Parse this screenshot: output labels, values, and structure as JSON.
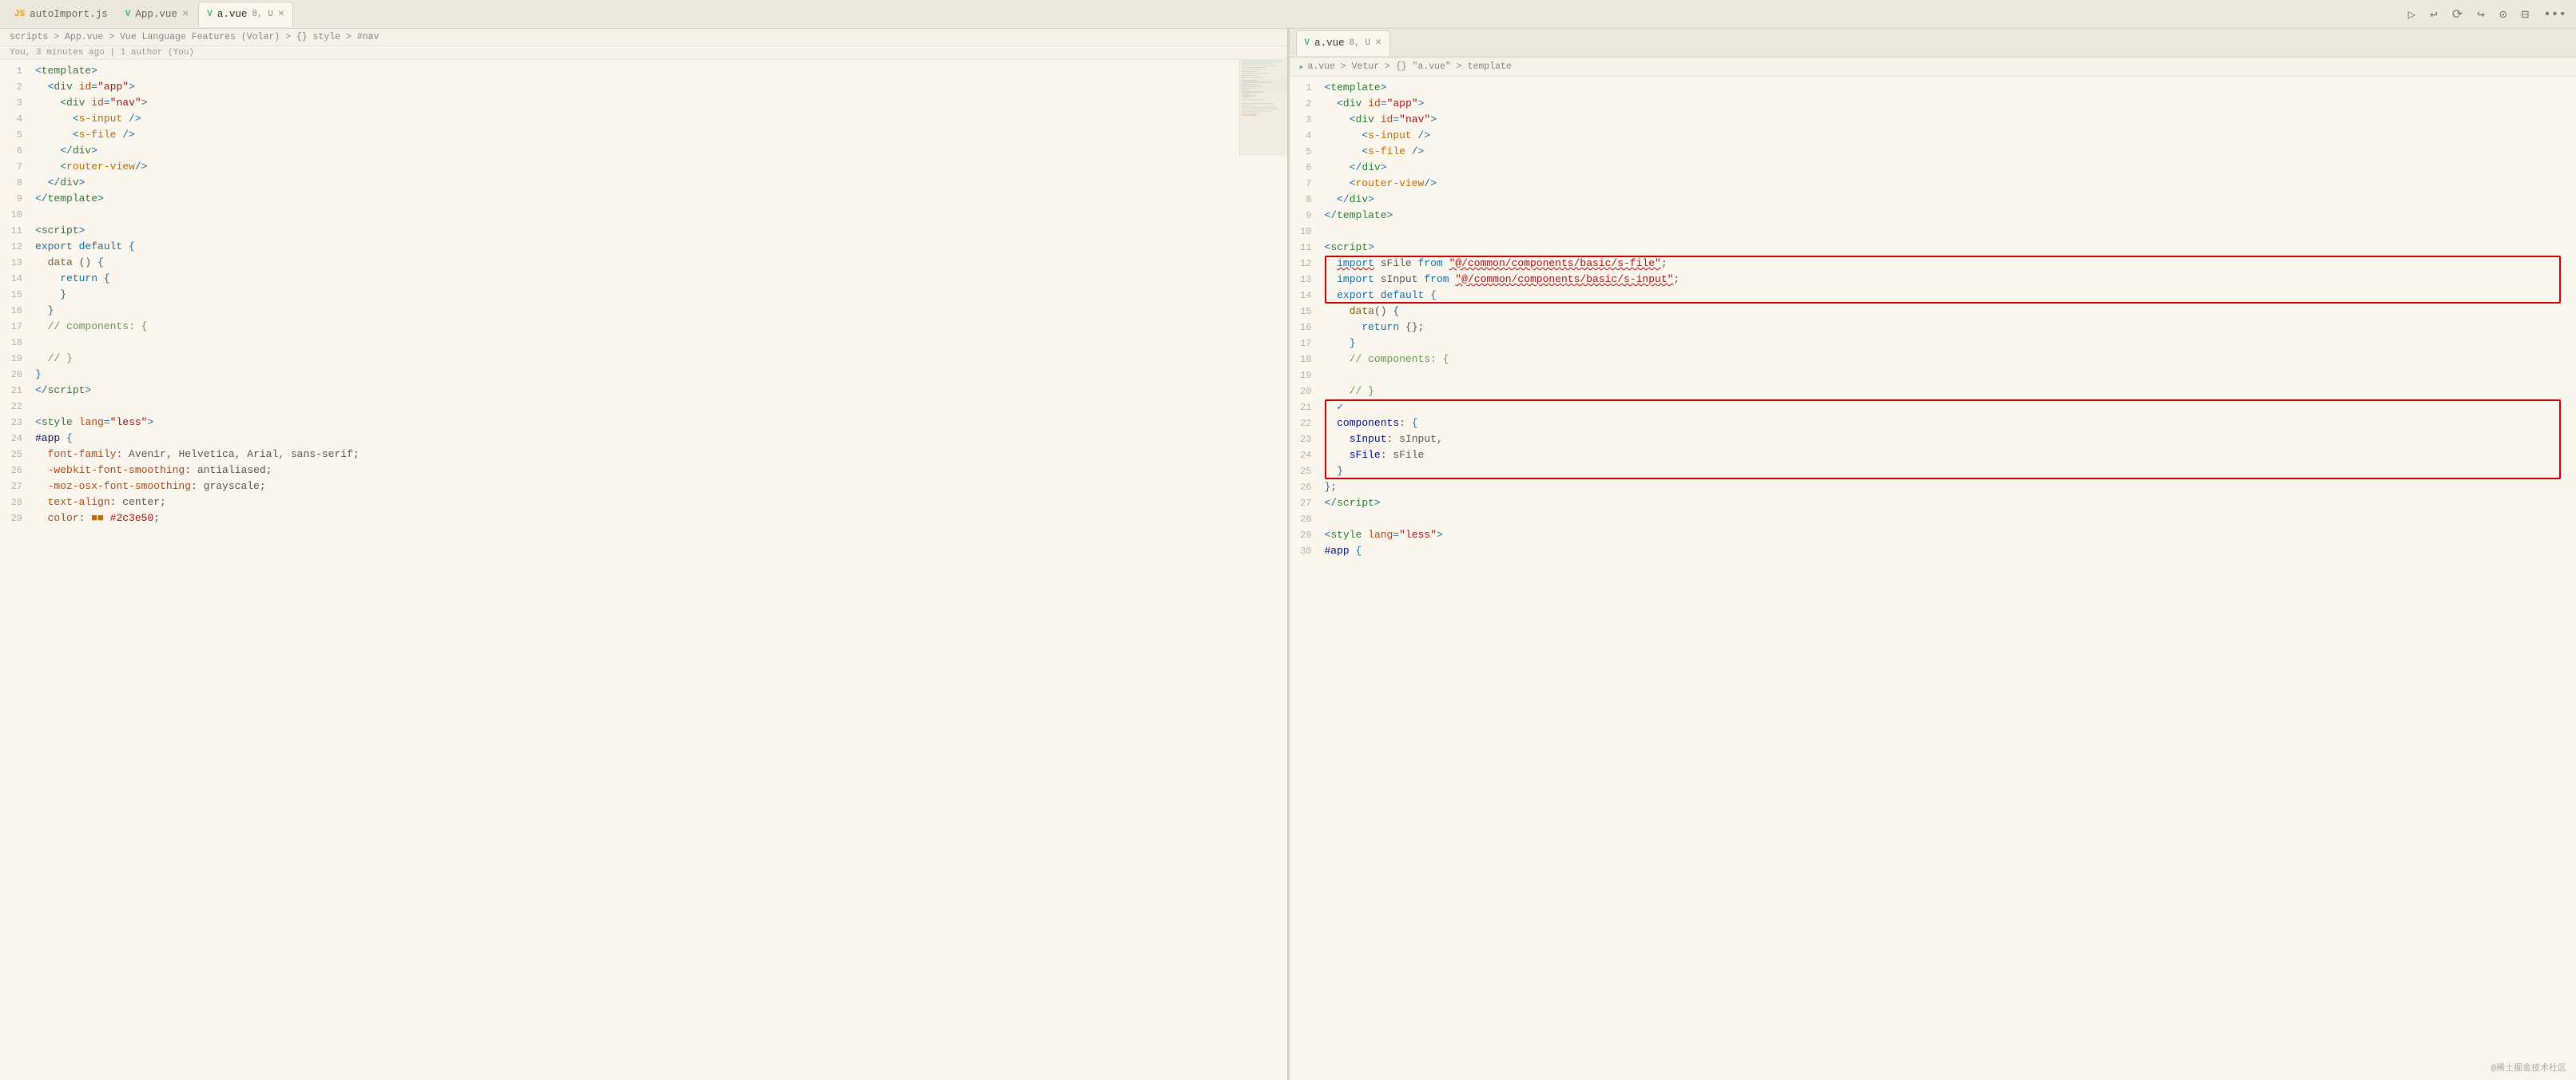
{
  "leftPanel": {
    "tabs": [
      {
        "label": "autoImport.js",
        "icon": "js",
        "active": false,
        "closable": false
      },
      {
        "label": "App.vue",
        "icon": "vue",
        "active": false,
        "closable": true
      },
      {
        "label": "a.vue",
        "badge": "8, U",
        "icon": "vue-green",
        "active": true,
        "closable": true
      }
    ],
    "breadcrumb": "scripts > App.vue > Vue Language Features (Volar) > {} style > #nav",
    "blame": "You, 3 minutes ago | 1 author (You)",
    "lines": [
      {
        "num": 1,
        "html": "<span class='kw-tag'>&lt;</span><span class='kw-name'>template</span><span class='kw-tag'>&gt;</span>"
      },
      {
        "num": 2,
        "html": "  <span class='kw-tag'>&lt;</span><span class='kw-name'>div</span> <span class='kw-attr'>id</span><span class='kw-tag'>=</span><span class='kw-string'>\"app\"</span><span class='kw-tag'>&gt;</span>"
      },
      {
        "num": 3,
        "html": "    <span class='kw-tag'>&lt;</span><span class='kw-name'>div</span> <span class='kw-attr'>id</span><span class='kw-tag'>=</span><span class='kw-string'>\"nav\"</span><span class='kw-tag'>&gt;</span>"
      },
      {
        "num": 4,
        "html": "      <span class='kw-tag'>&lt;</span><span class='kw-name kw-orange'>s-input</span> <span class='kw-tag'>/&gt;</span>"
      },
      {
        "num": 5,
        "html": "      <span class='kw-tag'>&lt;</span><span class='kw-name kw-orange'>s-file</span> <span class='kw-tag'>/&gt;</span>"
      },
      {
        "num": 6,
        "html": "    <span class='kw-tag'>&lt;/</span><span class='kw-name'>div</span><span class='kw-tag'>&gt;</span>"
      },
      {
        "num": 7,
        "html": "    <span class='kw-tag'>&lt;</span><span class='kw-name kw-orange'>router-view</span><span class='kw-tag'>/&gt;</span>"
      },
      {
        "num": 8,
        "html": "  <span class='kw-tag'>&lt;/</span><span class='kw-name'>div</span><span class='kw-tag'>&gt;</span>"
      },
      {
        "num": 9,
        "html": "<span class='kw-tag'>&lt;/</span><span class='kw-name'>template</span><span class='kw-tag'>&gt;</span>"
      },
      {
        "num": 10,
        "html": ""
      },
      {
        "num": 11,
        "html": "<span class='kw-tag'>&lt;</span><span class='kw-name'>script</span><span class='kw-tag'>&gt;</span>"
      },
      {
        "num": 12,
        "html": "<span class='kw-js-key'>export</span> <span class='kw-js-key'>default</span> <span class='kw-tag'>{</span>"
      },
      {
        "num": 13,
        "html": "  <span class='kw-js-fn'>data</span> () <span class='kw-tag'>{</span>"
      },
      {
        "num": 14,
        "html": "    <span class='kw-js-key'>return</span> <span class='kw-tag'>{</span>"
      },
      {
        "num": 15,
        "html": "    <span class='kw-tag'>}</span>"
      },
      {
        "num": 16,
        "html": "  <span class='kw-tag'>}</span>"
      },
      {
        "num": 17,
        "html": "  <span class='kw-comment'>// components: {</span>"
      },
      {
        "num": 18,
        "html": ""
      },
      {
        "num": 19,
        "html": "  <span class='kw-comment'>// }</span>"
      },
      {
        "num": 20,
        "html": "<span class='kw-tag'>}</span>"
      },
      {
        "num": 21,
        "html": "<span class='kw-tag'>&lt;/</span><span class='kw-name'>script</span><span class='kw-tag'>&gt;</span>"
      },
      {
        "num": 22,
        "html": ""
      },
      {
        "num": 23,
        "html": "<span class='kw-tag'>&lt;</span><span class='kw-name'>style</span> <span class='kw-attr'>lang</span><span class='kw-tag'>=</span><span class='kw-string'>\"less\"</span><span class='kw-tag'>&gt;</span>"
      },
      {
        "num": 24,
        "html": "<span class='kw-js-prop'>#app</span> <span class='kw-tag'>{</span>"
      },
      {
        "num": 25,
        "html": "  <span class='kw-attr'>font-family</span>: Avenir, Helvetica, Arial, sans-serif;"
      },
      {
        "num": 26,
        "html": "  <span class='kw-attr'>-webkit-font-smoothing</span>: antialiased;"
      },
      {
        "num": 27,
        "html": "  <span class='kw-attr'>-moz-osx-font-smoothing</span>: grayscale;"
      },
      {
        "num": 28,
        "html": "  <span class='kw-attr'>text-align</span>: center;"
      },
      {
        "num": 29,
        "html": "  <span class='kw-attr'>color</span>: <span class='kw-orange'>■■</span> <span class='kw-string'>#2c3e50</span>;"
      }
    ]
  },
  "rightPanel": {
    "tabs": [
      {
        "label": "a.vue",
        "badge": "8, U",
        "icon": "vue-green",
        "active": true,
        "closable": true
      }
    ],
    "breadcrumb": "a.vue > Vetur > {} \"a.vue\" > template",
    "lines": [
      {
        "num": 1,
        "html": "<span class='kw-tag'>&lt;</span><span class='kw-name'>template</span><span class='kw-tag'>&gt;</span>"
      },
      {
        "num": 2,
        "html": "  <span class='kw-tag'>&lt;</span><span class='kw-name'>div</span> <span class='kw-attr'>id</span><span class='kw-tag'>=</span><span class='kw-string'>\"app\"</span><span class='kw-tag'>&gt;</span>"
      },
      {
        "num": 3,
        "html": "    <span class='kw-tag'>&lt;</span><span class='kw-name'>div</span> <span class='kw-attr'>id</span><span class='kw-tag'>=</span><span class='kw-string'>\"nav\"</span><span class='kw-tag'>&gt;</span>"
      },
      {
        "num": 4,
        "html": "      <span class='kw-tag'>&lt;</span><span class='kw-name kw-orange'>s-input</span> <span class='kw-tag'>/&gt;</span>"
      },
      {
        "num": 5,
        "html": "      <span class='kw-tag'>&lt;</span><span class='kw-name kw-orange'>s-file</span> <span class='kw-tag'>/&gt;</span>"
      },
      {
        "num": 6,
        "html": "    <span class='kw-tag'>&lt;/</span><span class='kw-name'>div</span><span class='kw-tag'>&gt;</span>"
      },
      {
        "num": 7,
        "html": "    <span class='kw-tag'>&lt;</span><span class='kw-name kw-orange'>router-view</span><span class='kw-tag'>/&gt;</span>"
      },
      {
        "num": 8,
        "html": "  <span class='kw-tag'>&lt;/</span><span class='kw-name'>div</span><span class='kw-tag'>&gt;</span>"
      },
      {
        "num": 9,
        "html": "<span class='kw-tag'>&lt;/</span><span class='kw-name'>template</span><span class='kw-tag'>&gt;</span>"
      },
      {
        "num": 10,
        "html": ""
      },
      {
        "num": 11,
        "html": "<span class='kw-tag'>&lt;</span><span class='kw-name'>script</span><span class='kw-tag'>&gt;</span>"
      },
      {
        "num": 12,
        "html": "  <span class='kw-js-key squiggly'>import</span> sFile <span class='kw-js-key'>from</span> <span class='kw-import-path squiggly'>\"@/common/components/basic/s-file\"</span>;",
        "redbox": "top-start"
      },
      {
        "num": 13,
        "html": "  <span class='kw-js-key'>import</span> sInput <span class='kw-js-key'>from</span> <span class='kw-import-path squiggly'>\"@/common/components/basic/s-input\"</span>;",
        "redbox": "middle"
      },
      {
        "num": 14,
        "html": "  <span class='kw-js-key'>export</span> <span class='kw-js-key'>default</span> <span class='kw-tag'>{</span>",
        "redbox": "bottom-end"
      },
      {
        "num": 15,
        "html": "    <span class='kw-js-fn'>data</span>() <span class='kw-tag'>{</span>"
      },
      {
        "num": 16,
        "html": "      <span class='kw-js-key'>return</span> {};"
      },
      {
        "num": 17,
        "html": "    <span class='kw-tag'>}</span>"
      },
      {
        "num": 18,
        "html": "    <span class='kw-comment'>// components: {</span>"
      },
      {
        "num": 19,
        "html": ""
      },
      {
        "num": 20,
        "html": "    <span class='kw-comment'>// }</span>"
      },
      {
        "num": 21,
        "html": "  <span class='kw-tag'>✓</span>",
        "redbox2": "top-start2"
      },
      {
        "num": 22,
        "html": "  <span class='kw-js-prop'>components</span>: <span class='kw-tag'>{</span>",
        "redbox2": "middle2"
      },
      {
        "num": 23,
        "html": "    <span class='kw-js-prop'>sInput</span>: sInput,",
        "redbox2": "middle2"
      },
      {
        "num": 24,
        "html": "    <span class='kw-js-prop'>sFile</span>: sFile",
        "redbox2": "middle2"
      },
      {
        "num": 25,
        "html": "  <span class='kw-tag'>}</span>",
        "redbox2": "bottom-end2"
      },
      {
        "num": 26,
        "html": "<span class='kw-tag'>};</span>"
      },
      {
        "num": 27,
        "html": "<span class='kw-tag'>&lt;/</span><span class='kw-name'>script</span><span class='kw-tag'>&gt;</span>"
      },
      {
        "num": 28,
        "html": ""
      },
      {
        "num": 29,
        "html": "<span class='kw-tag'>&lt;</span><span class='kw-name'>style</span> <span class='kw-attr'>lang</span><span class='kw-tag'>=</span><span class='kw-string'>\"less\"</span><span class='kw-tag'>&gt;</span>"
      },
      {
        "num": 30,
        "html": "<span class='kw-js-prop'>#app</span> <span class='kw-tag'>{</span>"
      }
    ]
  },
  "watermark": "@稀土掘金技术社区"
}
